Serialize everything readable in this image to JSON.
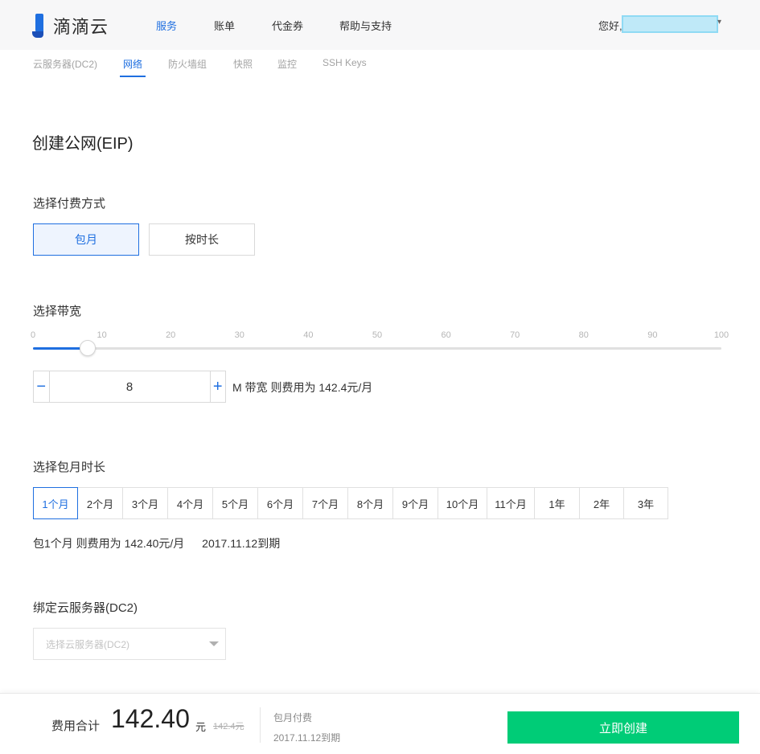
{
  "header": {
    "logo_text": "滴滴云",
    "nav": [
      "服务",
      "账单",
      "代金券",
      "帮助与支持"
    ],
    "greeting": "您好,",
    "user_caret": "▾"
  },
  "subnav": [
    "云服务器(DC2)",
    "网络",
    "防火墙组",
    "快照",
    "监控",
    "SSH Keys"
  ],
  "page": {
    "title": "创建公网(EIP)"
  },
  "billing": {
    "label": "选择付费方式",
    "options": [
      "包月",
      "按时长"
    ],
    "selected": "包月"
  },
  "bandwidth": {
    "label": "选择带宽",
    "ticks": [
      "0",
      "10",
      "20",
      "30",
      "40",
      "50",
      "60",
      "70",
      "80",
      "90",
      "100"
    ],
    "min": 0,
    "max": 100,
    "value": 8,
    "value_text": "8",
    "minus": "−",
    "plus": "+",
    "note": "M 带宽 则费用为 142.4元/月"
  },
  "duration": {
    "label": "选择包月时长",
    "options": [
      "1个月",
      "2个月",
      "3个月",
      "4个月",
      "5个月",
      "6个月",
      "7个月",
      "8个月",
      "9个月",
      "10个月",
      "11个月",
      "1年",
      "2年",
      "3年"
    ],
    "selected": "1个月",
    "summary_cost": "包1个月  则费用为 142.40元/月",
    "summary_expiry": "2017.11.12到期"
  },
  "bind": {
    "label": "绑定云服务器(DC2)",
    "placeholder": "选择云服务器(DC2)"
  },
  "footer": {
    "total_label": "费用合计",
    "total_amount": "142.40",
    "total_unit": "元",
    "old_price": "142.4元",
    "pay_type": "包月付费",
    "expiry": "2017.11.12到期",
    "buy_label": "立即创建"
  },
  "colors": {
    "accent": "#1f6fe0",
    "buy": "#00cc77"
  }
}
